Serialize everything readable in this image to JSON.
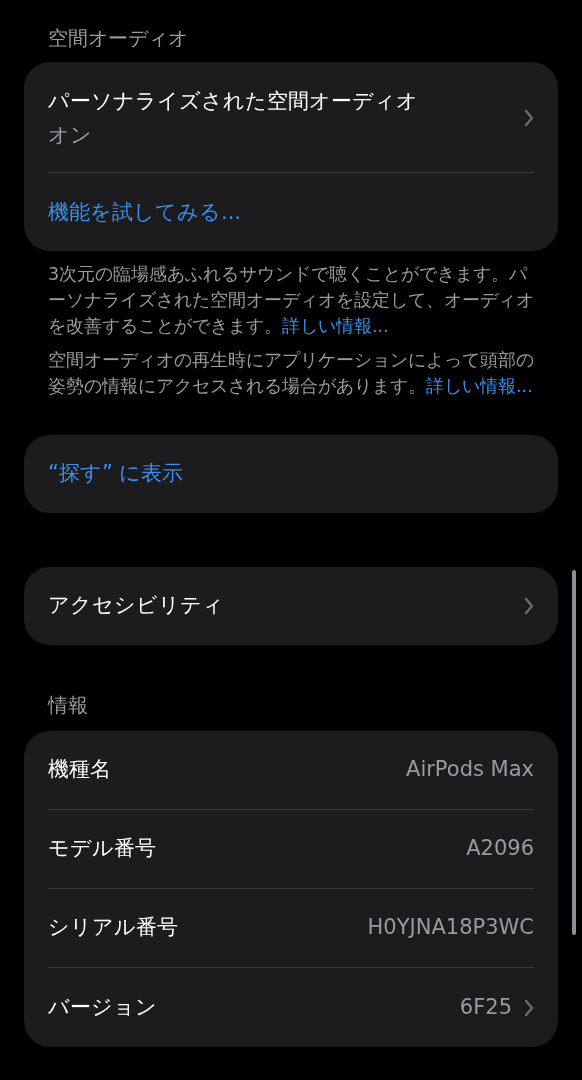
{
  "spatial_audio": {
    "header": "空間オーディオ",
    "row": {
      "title": "パーソナライズされた空間オーディオ",
      "value": "オン"
    },
    "action": "機能を試してみる...",
    "footer": [
      {
        "text": "3次元の臨場感あふれるサウンドで聴くことができます。パーソナライズされた空間オーディオを設定して、オーディオを改善することができます。",
        "link": "詳しい情報..."
      },
      {
        "text": "空間オーディオの再生時にアプリケーションによって頭部の姿勢の情報にアクセスされる場合があります。",
        "link": "詳しい情報..."
      }
    ]
  },
  "find_my": {
    "label": "“探す” に表示"
  },
  "accessibility": {
    "label": "アクセシビリティ"
  },
  "info": {
    "header": "情報",
    "rows": [
      {
        "label": "機種名",
        "value": "AirPods Max",
        "chevron": false
      },
      {
        "label": "モデル番号",
        "value": "A2096",
        "chevron": false
      },
      {
        "label": "シリアル番号",
        "value": "H0YJNA18P3WC",
        "chevron": false
      },
      {
        "label": "バージョン",
        "value": "6F25",
        "chevron": true
      }
    ]
  }
}
